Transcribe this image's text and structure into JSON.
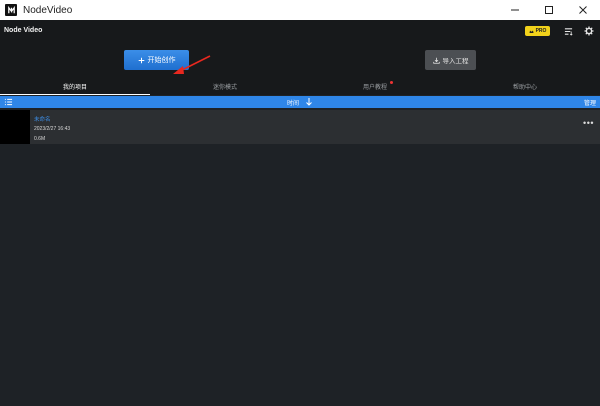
{
  "window": {
    "title": "NodeVideo"
  },
  "header": {
    "app_name": "Node Video",
    "pro_label": "PRO",
    "start_button": "开始创作",
    "import_button": "导入工程"
  },
  "tabs": [
    {
      "label": "我的项目",
      "active": true
    },
    {
      "label": "迷你模式",
      "active": false
    },
    {
      "label": "用户教程",
      "active": false,
      "badge": true
    },
    {
      "label": "帮助中心",
      "active": false
    }
  ],
  "sortbar": {
    "sort_label": "时间",
    "manage_label": "管理"
  },
  "projects": [
    {
      "title": "未命名",
      "date": "2023/2/27 16:43",
      "size": "0.6M"
    }
  ],
  "colors": {
    "accent": "#2f86e8",
    "annotation_arrow": "#e8281f",
    "pro_badge": "#f2d21b"
  }
}
